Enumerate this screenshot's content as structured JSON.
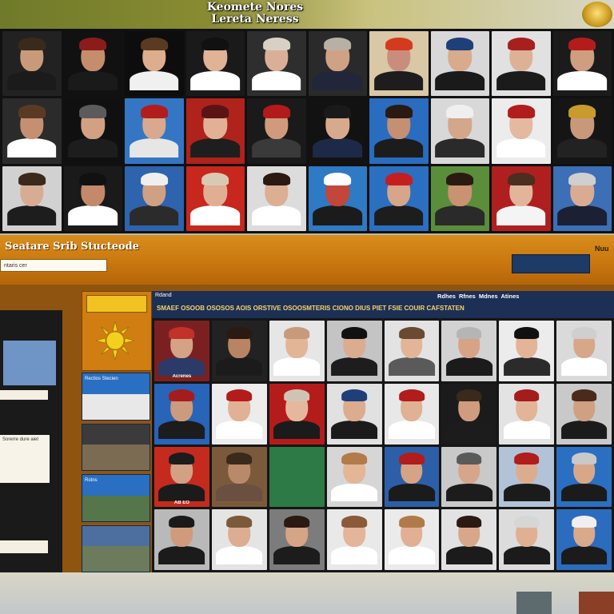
{
  "header": {
    "title_line1": "Keomete Nores",
    "title_line2": "Lereta Neress"
  },
  "top_grid": {
    "tiles": [
      {
        "bg": "#222",
        "skin": "#c99a7a",
        "hair": "#3a2a1c",
        "body": "#1b1b1b",
        "caption": ""
      },
      {
        "bg": "#111",
        "skin": "#c58d6b",
        "hair": "#8b1c1c",
        "body": "#1a1a1a",
        "caption": ""
      },
      {
        "bg": "#0d0d0d",
        "skin": "#dcae8d",
        "hair": "#5a3a22",
        "body": "#f0f0f0",
        "caption": ""
      },
      {
        "bg": "#1a1a1a",
        "skin": "#e0b296",
        "hair": "#111111",
        "body": "#ffffff",
        "caption": ""
      },
      {
        "bg": "#2e2e2e",
        "skin": "#d9b097",
        "hair": "#d9d0c4",
        "body": "#ffffff",
        "caption": ""
      },
      {
        "bg": "#2a2a2a",
        "skin": "#cfa285",
        "hair": "#b8b0a4",
        "body": "#22263a",
        "caption": ""
      },
      {
        "bg": "#d9c7a5",
        "skin": "#c98d7e",
        "hair": "#d43a1e",
        "body": "#1d1d1d",
        "caption": ""
      },
      {
        "bg": "#d8d8d8",
        "skin": "#d9ab8d",
        "hair": "#1e3f78",
        "body": "#1a1a1a",
        "caption": ""
      },
      {
        "bg": "#e1e1e1",
        "skin": "#ddb196",
        "hair": "#a81f1f",
        "body": "#1b1b1b",
        "caption": ""
      },
      {
        "bg": "#1b1b1b",
        "skin": "#cf9d80",
        "hair": "#b41c1c",
        "body": "#ffffff",
        "caption": ""
      },
      {
        "bg": "#2b2b2b",
        "skin": "#c58f72",
        "hair": "#5b3a24",
        "body": "#ffffff",
        "caption": ""
      },
      {
        "bg": "#101010",
        "skin": "#d2a083",
        "hair": "#5b5b5b",
        "body": "#1d1d1d",
        "caption": ""
      },
      {
        "bg": "#3476c4",
        "skin": "#d8a98e",
        "hair": "#b11d1d",
        "body": "#e6e6e6",
        "caption": ""
      },
      {
        "bg": "#b0221c",
        "skin": "#e1b095",
        "hair": "#5a1414",
        "body": "#1e1e1e",
        "caption": ""
      },
      {
        "bg": "#1a1a1a",
        "skin": "#cf9b7c",
        "hair": "#b11b1b",
        "body": "#3a3a3a",
        "caption": ""
      },
      {
        "bg": "#121212",
        "skin": "#d7aa8e",
        "hair": "#1a1a1a",
        "body": "#1c2a48",
        "caption": ""
      },
      {
        "bg": "#2a6cbf",
        "skin": "#c48f73",
        "hair": "#2a1a12",
        "body": "#1c1c1c",
        "caption": ""
      },
      {
        "bg": "#d8d8d8",
        "skin": "#d4a68a",
        "hair": "#efefef",
        "body": "#2a2a2a",
        "caption": ""
      },
      {
        "bg": "#ececec",
        "skin": "#e4b99f",
        "hair": "#b11c1c",
        "body": "#ffffff",
        "caption": ""
      },
      {
        "bg": "#151515",
        "skin": "#c9987b",
        "hair": "#c89b2c",
        "body": "#222222",
        "caption": ""
      },
      {
        "bg": "#d1d1d1",
        "skin": "#d8ac92",
        "hair": "#3a2a1c",
        "body": "#1d1d1d",
        "caption": ""
      },
      {
        "bg": "#1a1a1a",
        "skin": "#c3896a",
        "hair": "#111111",
        "body": "#ffffff",
        "caption": ""
      },
      {
        "bg": "#2e63ad",
        "skin": "#cfa083",
        "hair": "#efefef",
        "body": "#2b2b2b",
        "caption": ""
      },
      {
        "bg": "#c7271d",
        "skin": "#e0ae93",
        "hair": "#d9c9b4",
        "body": "#ffffff",
        "caption": ""
      },
      {
        "bg": "#dcdcdc",
        "skin": "#dcae92",
        "hair": "#2a1a12",
        "body": "#ffffff",
        "caption": ""
      },
      {
        "bg": "#2f7ac4",
        "skin": "#c2463a",
        "hair": "#ffffff",
        "body": "#1b1b1b",
        "caption": ""
      },
      {
        "bg": "#2b6fc0",
        "skin": "#d6a58a",
        "hair": "#c41f1f",
        "body": "#1d1d1d",
        "caption": ""
      },
      {
        "bg": "#5a8e3a",
        "skin": "#c99272",
        "hair": "#2a1a12",
        "body": "#2a2a2a",
        "caption": ""
      },
      {
        "bg": "#b01f1f",
        "skin": "#e2b59b",
        "hair": "#4b2e1e",
        "body": "#f4f4f4",
        "caption": ""
      },
      {
        "bg": "#3c6fb5",
        "skin": "#d9ab92",
        "hair": "#cfcfcf",
        "body": "#1b2034",
        "caption": ""
      }
    ]
  },
  "mid_bar": {
    "title": "Seatare Srib Stucteode",
    "field_text": "ntaris cer",
    "button_label": "",
    "right_label": "Nuu"
  },
  "lower": {
    "logo_label": "",
    "header_label": "Rdand",
    "header_tabs": "Rdhes Rfnes Mdnes Atines",
    "header_ticker": "SMAEF OSOOB OSOSOS AOIS ORSTIVE OSOOSMTERIS CIONO DIUS PIET FSIE COUIR CAFSTATEN",
    "side_items": [
      {
        "label": "Rectios Stecien",
        "bg": "#2a6fc2",
        "scene": "#e8e8e8"
      },
      {
        "label": "",
        "bg": "#3b3b3b",
        "scene": "#7b6b52"
      },
      {
        "label": "Rotns",
        "bg": "#2a6fc2",
        "scene": "#55754a"
      },
      {
        "label": "",
        "bg": "#4c6fa0",
        "scene": "#6b7b5b"
      }
    ],
    "left_card2_text": "Sorerre dure aiet",
    "tiles": [
      {
        "bg": "#7b2020",
        "skin": "#d4a284",
        "hair": "#c0322a",
        "body": "#2b3a68",
        "caption": "Acrenes"
      },
      {
        "bg": "#222",
        "skin": "#b98463",
        "hair": "#2a1a12",
        "body": "#1b1b1b",
        "caption": ""
      },
      {
        "bg": "#e6e6e6",
        "skin": "#e3b597",
        "hair": "#c79a7c",
        "body": "#ffffff",
        "caption": ""
      },
      {
        "bg": "#c4c4c4",
        "skin": "#dbac90",
        "hair": "#111111",
        "body": "#1d1d1d",
        "caption": ""
      },
      {
        "bg": "#e3e3e3",
        "skin": "#e2b597",
        "hair": "#6a4a32",
        "body": "#5a5a5a",
        "caption": ""
      },
      {
        "bg": "#d2d2d2",
        "skin": "#d7a387",
        "hair": "#b5b5b5",
        "body": "#1b1b1b",
        "caption": ""
      },
      {
        "bg": "#ececec",
        "skin": "#e4b497",
        "hair": "#111111",
        "body": "#2b2b2b",
        "caption": ""
      },
      {
        "bg": "#dadada",
        "skin": "#d7a78a",
        "hair": "#cfcfcf",
        "body": "#ffffff",
        "caption": ""
      },
      {
        "bg": "#2864b8",
        "skin": "#cc9a7c",
        "hair": "#a51c1c",
        "body": "#1c1c1c",
        "caption": ""
      },
      {
        "bg": "#ececec",
        "skin": "#e0b195",
        "hair": "#b41c1c",
        "body": "#ffffff",
        "caption": ""
      },
      {
        "bg": "#b41c1c",
        "skin": "#e5b89d",
        "hair": "#cfc4b4",
        "body": "#1b1b1b",
        "caption": ""
      },
      {
        "bg": "#e1e1e1",
        "skin": "#dcac8f",
        "hair": "#1e3f78",
        "body": "#1b1b1b",
        "caption": ""
      },
      {
        "bg": "#e8e8e8",
        "skin": "#e0b193",
        "hair": "#b11c1c",
        "body": "#ffffff",
        "caption": ""
      },
      {
        "bg": "#1b1b1b",
        "skin": "#cf9c7e",
        "hair": "#3a2a1c",
        "body": "#1c1c1c",
        "caption": ""
      },
      {
        "bg": "#e3e3e3",
        "skin": "#e2b498",
        "hair": "#a51c1c",
        "body": "#ffffff",
        "caption": ""
      },
      {
        "bg": "#c9c9c9",
        "skin": "#d0a083",
        "hair": "#4a2a1a",
        "body": "#1b1b1b",
        "caption": ""
      },
      {
        "bg": "#c52a1e",
        "skin": "#d2a082",
        "hair": "#1c1c1c",
        "body": "#1b1b1b",
        "caption": "AB EO"
      },
      {
        "bg": "#7b5a3c",
        "skin": "#b98a6a",
        "hair": "#3a2a1c",
        "body": "#6a5040",
        "caption": ""
      },
      {
        "bg": "#2d7a47",
        "skin": "#2d7a47",
        "hair": "#2d7a47",
        "body": "#2d7a47",
        "caption": ""
      },
      {
        "bg": "#d6d6d6",
        "skin": "#e3b696",
        "hair": "#b37a4a",
        "body": "#ffffff",
        "caption": ""
      },
      {
        "bg": "#2c5fa8",
        "skin": "#d5a386",
        "hair": "#b11c1c",
        "body": "#1b1b1b",
        "caption": ""
      },
      {
        "bg": "#c9c9c9",
        "skin": "#d6a68a",
        "hair": "#5a5a5a",
        "body": "#1c1c1c",
        "caption": ""
      },
      {
        "bg": "#b2c3d8",
        "skin": "#dcac8f",
        "hair": "#b11c1c",
        "body": "#1b1b1b",
        "caption": ""
      },
      {
        "bg": "#2a6fc2",
        "skin": "#d8a78a",
        "hair": "#c9c9c9",
        "body": "#1b1b1b",
        "caption": ""
      },
      {
        "bg": "#b9b9b9",
        "skin": "#cf9b7c",
        "hair": "#1a1a1a",
        "body": "#1b1b1b",
        "caption": ""
      },
      {
        "bg": "#e4e4e4",
        "skin": "#dcad90",
        "hair": "#7a5a3a",
        "body": "#ffffff",
        "caption": ""
      },
      {
        "bg": "#7c7c7c",
        "skin": "#d6a486",
        "hair": "#2a1a12",
        "body": "#1c1c1c",
        "caption": ""
      },
      {
        "bg": "#e9e9e9",
        "skin": "#e4b598",
        "hair": "#8a5a3a",
        "body": "#ffffff",
        "caption": ""
      },
      {
        "bg": "#ebebeb",
        "skin": "#e1b094",
        "hair": "#b07a4a",
        "body": "#ffffff",
        "caption": ""
      },
      {
        "bg": "#e2e2e2",
        "skin": "#d8a78a",
        "hair": "#2a1a12",
        "body": "#1b1b1b",
        "caption": ""
      },
      {
        "bg": "#dcdcdc",
        "skin": "#e0b093",
        "hair": "#d6d6d6",
        "body": "#1b1b1b",
        "caption": ""
      },
      {
        "bg": "#2c6cbf",
        "skin": "#d9a98b",
        "hair": "#efefef",
        "body": "#1b1b1b",
        "caption": ""
      }
    ]
  }
}
